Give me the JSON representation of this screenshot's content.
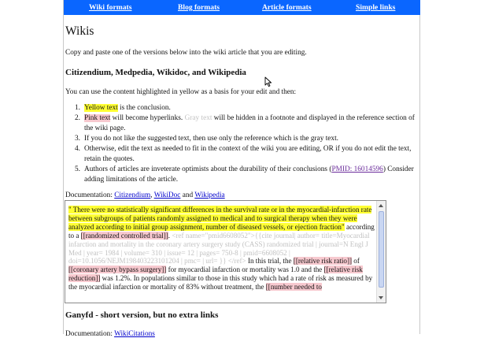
{
  "nav": {
    "wiki": "Wiki formats",
    "blog": "Blog formats",
    "article": "Article formats",
    "simple": "Simple links"
  },
  "title": "Wikis",
  "intro": "Copy and paste one of the versions below into the wiki article that you are editing.",
  "section1": {
    "heading": "Citizendium, Medpedia, Wikidoc, and Wikipedia",
    "lead": "You can use the content highlighted in yellow as a basis for your edit and then:",
    "items": [
      {
        "num": "1.",
        "hl": "Yellow text",
        "rest": " is the conclusion."
      },
      {
        "num": "2.",
        "hl": "Pink text",
        "mid": " will become hyperlinks. ",
        "gray": "Gray text",
        "rest": " will be hidden in a footnote and displayed in the reference section of the wiki page."
      },
      {
        "num": "3.",
        "text": "If you do not like the suggested text, then use only the reference which is the gray text."
      },
      {
        "num": "4.",
        "text": "Otherwise, edit the text as needed to fit in the context of the wiki you are editing, OR if you do not edit the text, retain the quotes."
      },
      {
        "num": "5.",
        "pre": "Authors of articles are inveterate optimists about the durability of their conclusions (",
        "link": "PMID: 16014596",
        "post": ") Consider adding limitations of the article."
      }
    ],
    "documentation_label": "Documentation: ",
    "doc_links": [
      "Citizendium",
      "WikiDoc",
      "Wikipedia"
    ],
    "doc_sep1": ", ",
    "doc_sep2": " and ",
    "textbox": {
      "yellow": "\" There were no statistically significant differences in the survival rate or in the myocardial-infarction rate between subgroups of patients randomly assigned to medical and to surgical therapy when they were analyzed according to initial group assignment, number of diseased vessels, or ejection fraction\"",
      "t1": " according to a ",
      "pink1": "[[randomized controlled trial]]",
      "t2": ". ",
      "gray": "<ref name=\"pmid6608052\">{{cite journal| author= title=Myocardial infarction and mortality in the coronary artery surgery study (CASS) randomized trial | journal=N Engl J Med | year= 1984 | volume= 310 | issue= 12 | pages= 750-8 | pmid=6608052 | doi=10.1056/NEJM198403223101204 | pmc= | url= }} </ref>",
      "t3": " In this trial, the ",
      "pink2": "[[relative risk ratio]]",
      "t4": " of ",
      "pink3": "[[coronary artery bypass surgery]]",
      "t5": " for myocardial infarction or mortality was 1.0 and the ",
      "pink4": "[[relative risk reduction]]",
      "t6": " was 1.2%. In populations similar to those in this study which had a rate of risk as measured by the myocardial infarction or mortality of 83% without treatment, the ",
      "pink5": "[[number needed to"
    }
  },
  "section2": {
    "heading": "Ganyfd - short version, but no extra links",
    "documentation_label": "Documentation: ",
    "doc_link": "WikiCitations"
  }
}
